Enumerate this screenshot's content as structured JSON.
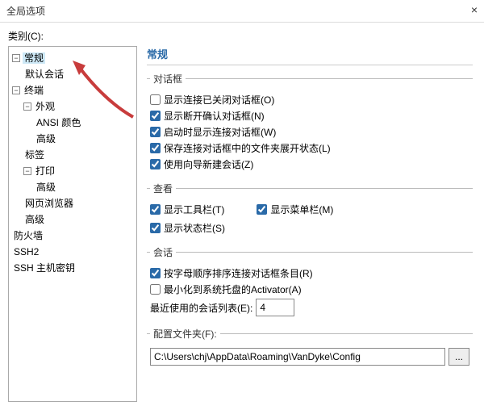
{
  "window": {
    "title": "全局选项",
    "close": "×"
  },
  "category_label": "类别(C):",
  "tree": {
    "general": "常规",
    "default_session": "默认会话",
    "terminal": "终端",
    "appearance": "外观",
    "ansi_color": "ANSI 颜色",
    "advanced1": "高级",
    "tabs": "标签",
    "print": "打印",
    "advanced2": "高级",
    "web_browser": "网页浏览器",
    "advanced3": "高级",
    "firewall": "防火墙",
    "ssh2": "SSH2",
    "ssh_hostkey": "SSH 主机密钥"
  },
  "content": {
    "heading": "常规",
    "dialog_section": "对话框",
    "show_closed": "显示连接已关闭对话框(O)",
    "show_disconnect": "显示断开确认对话框(N)",
    "show_connect_startup": "启动时显示连接对话框(W)",
    "save_expand_state": "保存连接对话框中的文件夹展开状态(L)",
    "use_wizard": "使用向导新建会话(Z)",
    "view_section": "查看",
    "show_toolbar": "显示工具栏(T)",
    "show_menubar": "显示菜单栏(M)",
    "show_statusbar": "显示状态栏(S)",
    "session_section": "会话",
    "sort_alpha": "按字母顺序排序连接对话框条目(R)",
    "minimize_tray": "最小化到系统托盘的Activator(A)",
    "recent_label": "最近使用的会话列表(E):",
    "recent_value": "4",
    "config_label": "配置文件夹(F):",
    "config_value": "C:\\Users\\chj\\AppData\\Roaming\\VanDyke\\Config",
    "browse": "..."
  },
  "checks": {
    "show_closed": false,
    "show_disconnect": true,
    "show_connect_startup": true,
    "save_expand_state": true,
    "use_wizard": true,
    "show_toolbar": true,
    "show_menubar": true,
    "show_statusbar": true,
    "sort_alpha": true,
    "minimize_tray": false
  }
}
